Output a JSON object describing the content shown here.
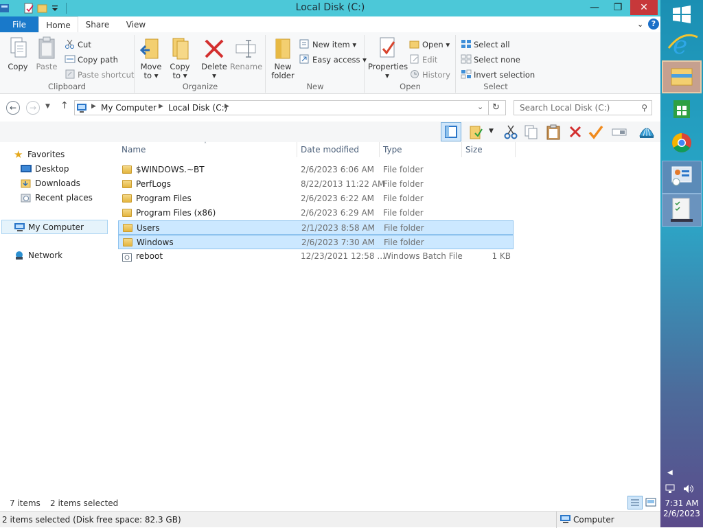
{
  "window": {
    "title": "Local Disk (C:)"
  },
  "tabs": [
    "File",
    "Home",
    "Share",
    "View"
  ],
  "ribbon": {
    "clipboard": {
      "label": "Clipboard",
      "copy": "Copy",
      "paste": "Paste",
      "cut": "Cut",
      "copy_path": "Copy path",
      "paste_shortcut": "Paste shortcut"
    },
    "organize": {
      "label": "Organize",
      "move_to": [
        "Move",
        "to"
      ],
      "copy_to": [
        "Copy",
        "to"
      ],
      "delete": "Delete",
      "rename": "Rename"
    },
    "new": {
      "label": "New",
      "new_folder": [
        "New",
        "folder"
      ],
      "new_item": "New item",
      "easy_access": "Easy access"
    },
    "open": {
      "label": "Open",
      "properties": "Properties",
      "open": "Open",
      "edit": "Edit",
      "history": "History"
    },
    "select": {
      "label": "Select",
      "select_all": "Select all",
      "select_none": "Select none",
      "invert": "Invert selection"
    }
  },
  "address": {
    "crumbs": [
      "My Computer",
      "Local Disk (C:)"
    ],
    "search_placeholder": "Search Local Disk (C:)"
  },
  "nav": {
    "favorites": "Favorites",
    "desktop": "Desktop",
    "downloads": "Downloads",
    "recent": "Recent places",
    "computer": "My Computer",
    "network": "Network"
  },
  "columns": {
    "name": "Name",
    "date": "Date modified",
    "type": "Type",
    "size": "Size"
  },
  "files": [
    {
      "name": "$WINDOWS.~BT",
      "date": "2/6/2023 6:06 AM",
      "type": "File folder",
      "size": "",
      "selected": false,
      "kind": "folder"
    },
    {
      "name": "PerfLogs",
      "date": "8/22/2013 11:22 AM",
      "type": "File folder",
      "size": "",
      "selected": false,
      "kind": "folder"
    },
    {
      "name": "Program Files",
      "date": "2/6/2023 6:22 AM",
      "type": "File folder",
      "size": "",
      "selected": false,
      "kind": "folder"
    },
    {
      "name": "Program Files (x86)",
      "date": "2/6/2023 6:29 AM",
      "type": "File folder",
      "size": "",
      "selected": false,
      "kind": "folder"
    },
    {
      "name": "Users",
      "date": "2/1/2023 8:58 AM",
      "type": "File folder",
      "size": "",
      "selected": true,
      "kind": "folder"
    },
    {
      "name": "Windows",
      "date": "2/6/2023 7:30 AM",
      "type": "File folder",
      "size": "",
      "selected": true,
      "kind": "folder"
    },
    {
      "name": "reboot",
      "date": "12/23/2021 12:58 ...",
      "type": "Windows Batch File",
      "size": "1 KB",
      "selected": false,
      "kind": "batch"
    }
  ],
  "itemsbar": {
    "count": "7 items",
    "selected": "2 items selected"
  },
  "statusbar": {
    "text": "2 items selected (Disk free space: 82.3 GB)",
    "location": "Computer"
  },
  "taskbar": {
    "time": "7:31 AM",
    "date": "2/6/2023"
  }
}
